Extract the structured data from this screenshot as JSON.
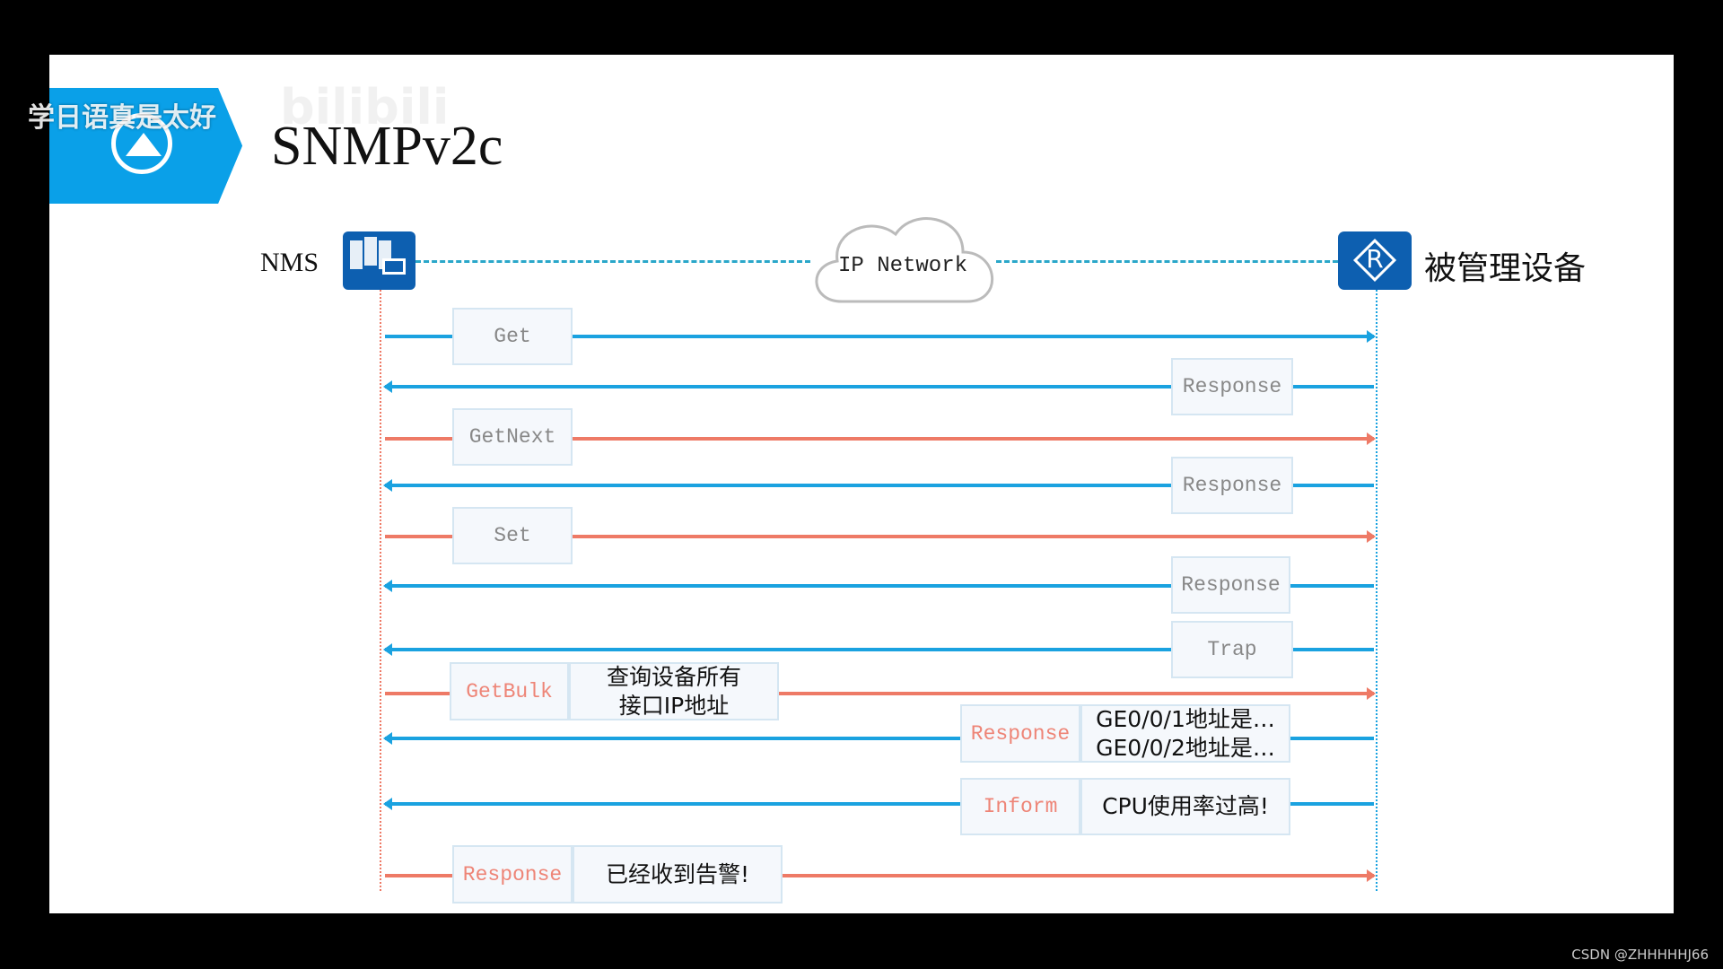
{
  "title": "SNMPv2c",
  "overlay_watermark": "学日语真是太好",
  "bilibili_watermark": "bilibili",
  "nms_label": "NMS",
  "network_label": "IP Network",
  "device_label": "被管理设备",
  "router_letter": "R",
  "credit": "CSDN @ZHHHHHJ66",
  "colors": {
    "request": "#ee7a66",
    "response": "#1aa2e0",
    "banner": "#0aa0e8",
    "icon": "#0d5fb0"
  },
  "messages": [
    {
      "label": "Get",
      "direction": "to-device",
      "color": "response",
      "label_color": "gray"
    },
    {
      "label": "Response",
      "direction": "to-nms",
      "color": "response",
      "label_color": "gray"
    },
    {
      "label": "GetNext",
      "direction": "to-device",
      "color": "request",
      "label_color": "gray"
    },
    {
      "label": "Response",
      "direction": "to-nms",
      "color": "response",
      "label_color": "gray"
    },
    {
      "label": "Set",
      "direction": "to-device",
      "color": "request",
      "label_color": "gray"
    },
    {
      "label": "Response",
      "direction": "to-nms",
      "color": "response",
      "label_color": "gray"
    },
    {
      "label": "Trap",
      "direction": "to-nms",
      "color": "response",
      "label_color": "gray"
    },
    {
      "label": "GetBulk",
      "direction": "to-device",
      "color": "request",
      "label_color": "red",
      "note": "查询设备所有\n接口IP地址"
    },
    {
      "label": "Response",
      "direction": "to-nms",
      "color": "response",
      "label_color": "red",
      "note": "GE0/0/1地址是…\nGE0/0/2地址是…"
    },
    {
      "label": "Inform",
      "direction": "to-nms",
      "color": "response",
      "label_color": "red",
      "note": "CPU使用率过高!"
    },
    {
      "label": "Response",
      "direction": "to-device",
      "color": "request",
      "label_color": "red",
      "note": "已经收到告警!"
    }
  ]
}
